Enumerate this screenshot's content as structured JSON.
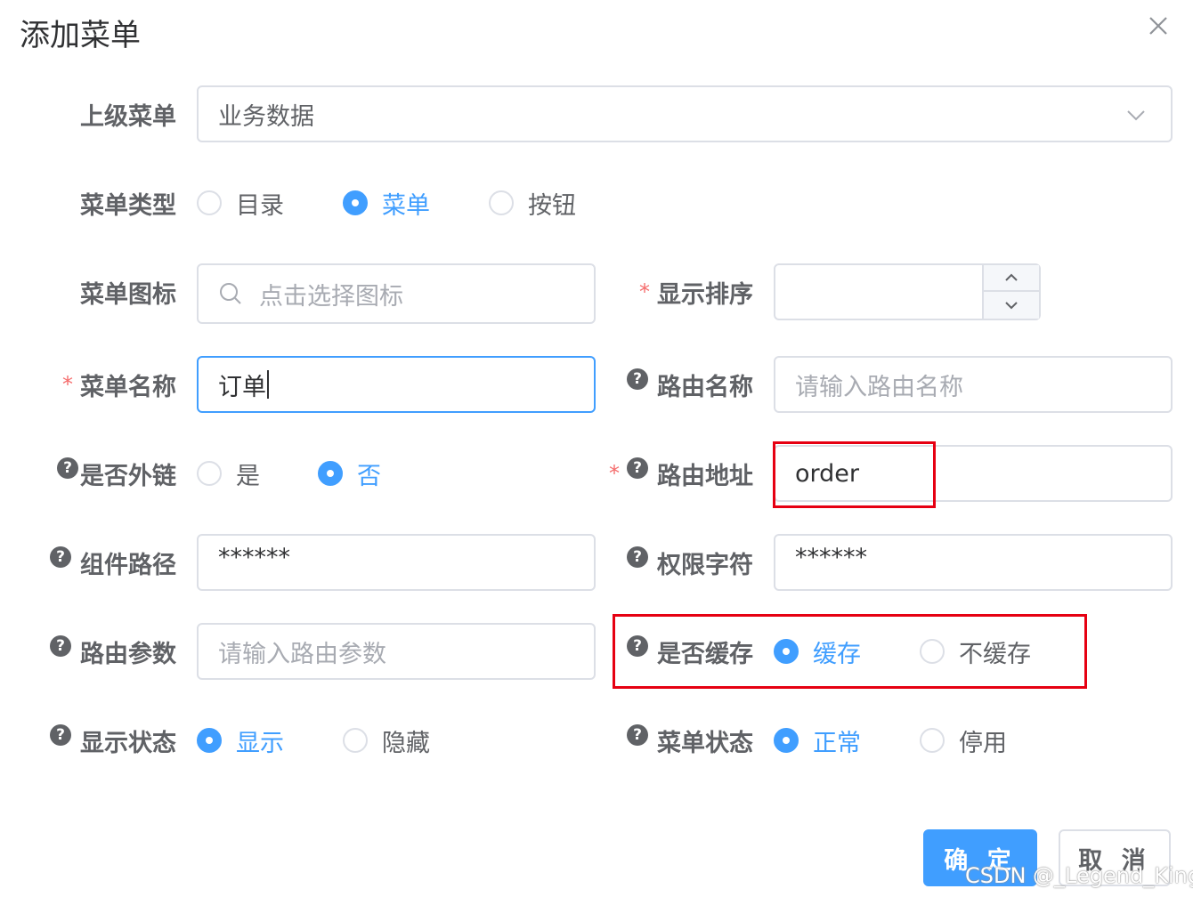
{
  "dialog": {
    "title": "添加菜单",
    "close_label": "×"
  },
  "form": {
    "parent_menu": {
      "label": "上级菜单",
      "value": "业务数据"
    },
    "menu_type": {
      "label": "菜单类型",
      "options": [
        {
          "label": "目录",
          "checked": false
        },
        {
          "label": "菜单",
          "checked": true
        },
        {
          "label": "按钮",
          "checked": false
        }
      ]
    },
    "menu_icon": {
      "label": "菜单图标",
      "placeholder": "点击选择图标"
    },
    "display_order": {
      "label": "显示排序",
      "required_mark": "*",
      "value": ""
    },
    "menu_name": {
      "label": "菜单名称",
      "required_mark": "*",
      "value": "订单"
    },
    "route_name": {
      "label": "路由名称",
      "help": "?",
      "placeholder": "请输入路由名称"
    },
    "is_external": {
      "label": "是否外链",
      "help": "?",
      "options": [
        {
          "label": "是",
          "checked": false
        },
        {
          "label": "否",
          "checked": true
        }
      ]
    },
    "route_path": {
      "label": "路由地址",
      "required_mark": "*",
      "help": "?",
      "value": "order"
    },
    "component_path": {
      "label": "组件路径",
      "help": "?",
      "value": "******"
    },
    "permission": {
      "label": "权限字符",
      "help": "?",
      "value": "******"
    },
    "route_params": {
      "label": "路由参数",
      "help": "?",
      "placeholder": "请输入路由参数"
    },
    "is_cache": {
      "label": "是否缓存",
      "help": "?",
      "options": [
        {
          "label": "缓存",
          "checked": true
        },
        {
          "label": "不缓存",
          "checked": false
        }
      ]
    },
    "visible": {
      "label": "显示状态",
      "help": "?",
      "options": [
        {
          "label": "显示",
          "checked": true
        },
        {
          "label": "隐藏",
          "checked": false
        }
      ]
    },
    "status": {
      "label": "菜单状态",
      "help": "?",
      "options": [
        {
          "label": "正常",
          "checked": true
        },
        {
          "label": "停用",
          "checked": false
        }
      ]
    }
  },
  "footer": {
    "confirm_label": "确 定",
    "cancel_label": "取 消"
  },
  "watermark": "CSDN @_Legend_King",
  "colors": {
    "primary": "#409eff",
    "required": "#f56c6c",
    "highlight": "#e60012"
  }
}
